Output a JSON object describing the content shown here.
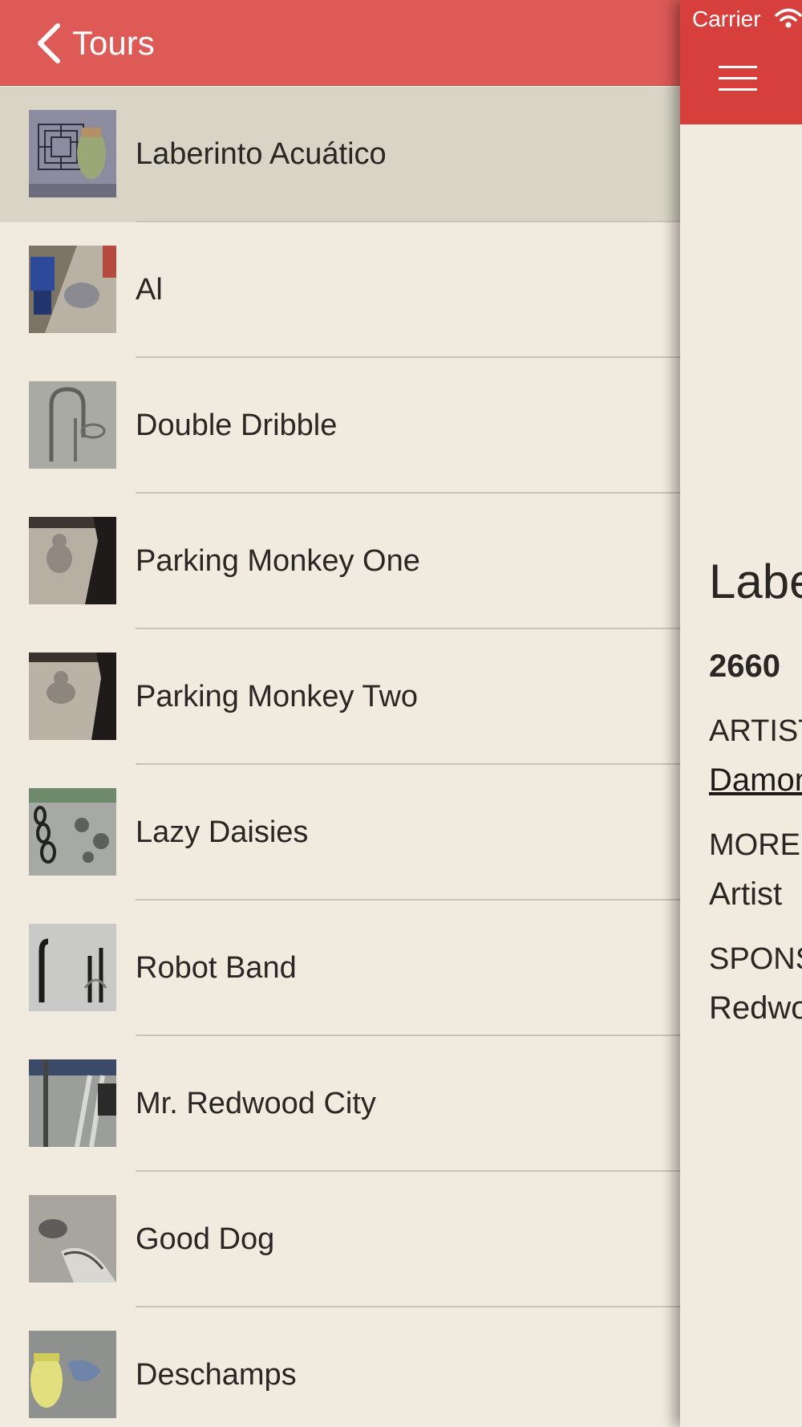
{
  "menu": {
    "back_label": "Tours",
    "items": [
      {
        "title": "Laberinto Acuático",
        "selected": true
      },
      {
        "title": "Al"
      },
      {
        "title": "Double Dribble"
      },
      {
        "title": "Parking Monkey One"
      },
      {
        "title": "Parking Monkey Two"
      },
      {
        "title": "Lazy Daisies"
      },
      {
        "title": "Robot Band"
      },
      {
        "title": "Mr. Redwood City"
      },
      {
        "title": "Good Dog"
      },
      {
        "title": "Deschamps"
      }
    ]
  },
  "status_bar": {
    "carrier": "Carrier"
  },
  "detail": {
    "title": "Labe",
    "address": "2660",
    "artist_label": "ARTIST",
    "artist_name": "Damon",
    "more_label": "MORE",
    "more_value": "Artist",
    "sponsor_label": "SPONS",
    "sponsor_value": "Redwo"
  },
  "colors": {
    "menu_header": "#dd5a57",
    "detail_header": "#d63f3c",
    "list_background": "#f1ebdf",
    "selected_row": "#d8d5c6"
  }
}
